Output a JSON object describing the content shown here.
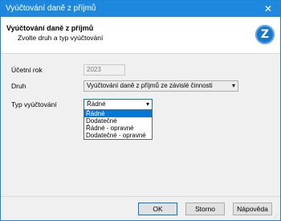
{
  "window": {
    "title": "Vyúčtování daně z příjmů",
    "close_glyph": "✕"
  },
  "header": {
    "title": "Vyúčtování daně z příjmů",
    "subtitle": "Zvolte druh a typ vyúčtování",
    "logo_glyph": "Z",
    "logo_color": "#1b76c9"
  },
  "form": {
    "year": {
      "label": "Účetní rok",
      "value": "2023"
    },
    "kind": {
      "label": "Druh",
      "value": "Vyúčtování daně z příjmů ze závislé činnosti"
    },
    "type": {
      "label": "Typ vyúčtování",
      "value": "Řádné",
      "options": [
        "Řádné",
        "Dodatečné",
        "Řádné - opravné",
        "Dodatečné - opravné"
      ],
      "selected_index": 0
    }
  },
  "buttons": {
    "ok": "OK",
    "cancel": "Storno",
    "help": "Nápověda"
  },
  "colors": {
    "accent": "#1e88df",
    "selection": "#0078d7"
  }
}
